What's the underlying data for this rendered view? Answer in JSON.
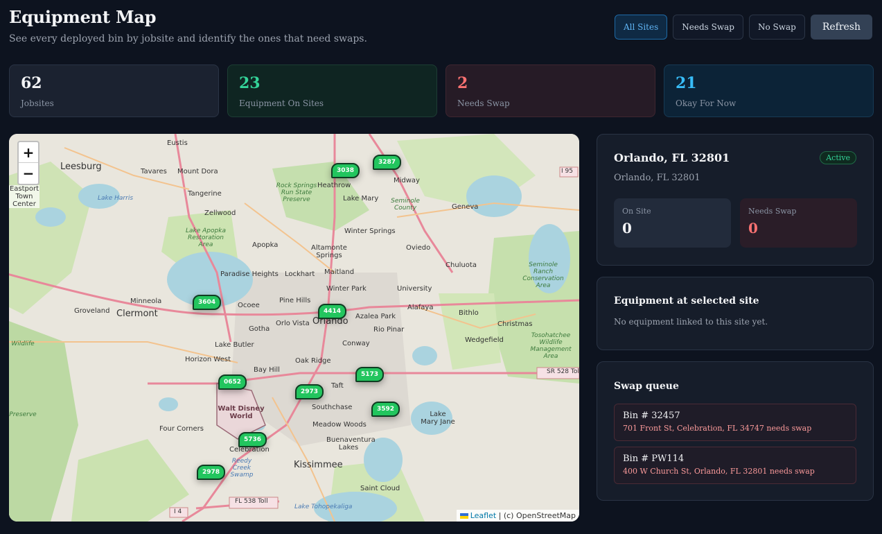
{
  "header": {
    "title": "Equipment Map",
    "subtitle": "See every deployed bin by jobsite and identify the ones that need swaps."
  },
  "filters": {
    "all_sites": "All Sites",
    "needs_swap": "Needs Swap",
    "no_swap": "No Swap",
    "refresh": "Refresh",
    "active_filter": "All Sites"
  },
  "stats": [
    {
      "value": "62",
      "label": "Jobsites"
    },
    {
      "value": "23",
      "label": "Equipment On Sites"
    },
    {
      "value": "2",
      "label": "Needs Swap"
    },
    {
      "value": "21",
      "label": "Okay For Now"
    }
  ],
  "map": {
    "zoom_in": "+",
    "zoom_out": "−",
    "attribution_leaflet": "Leaflet",
    "attribution_rest": " | (c) OpenStreetMap",
    "markers": [
      "3038",
      "3287",
      "3604",
      "4414",
      "5173",
      "0652",
      "2973",
      "3592",
      "5736",
      "2978"
    ],
    "place_labels": [
      "Eustis",
      "Leesburg",
      "Tavares",
      "Mount Dora",
      "Tangerine",
      "Zellwood",
      "Apopka",
      "Heathrow",
      "Midway",
      "Lake Mary",
      "Geneva",
      "Winter Springs",
      "Oviedo",
      "Altamonte Springs",
      "Chuluota",
      "Maitland",
      "Paradise Heights",
      "Lockhart",
      "Winter Park",
      "University",
      "Minneola",
      "Clermont",
      "Groveland",
      "Ocoee",
      "Pine Hills",
      "Alafaya",
      "Orlando",
      "Azalea Park",
      "Bithlo",
      "Christmas",
      "Gotha",
      "Orlo Vista",
      "Rio Pinar",
      "Wedgefield",
      "Lake Butler",
      "Conway",
      "Horizon West",
      "Oak Ridge",
      "Bay Hill",
      "Taft",
      "Walt Disney World",
      "Southchase",
      "Lake Mary Jane",
      "Four Corners",
      "Meadow Woods",
      "Celebration",
      "Buenaventura Lakes",
      "Kissimmee",
      "Saint Cloud",
      "Eastport Town Center",
      "Lake Harris",
      "Rock Springs Run State Preserve",
      "Seminole County",
      "Lake Apopka Restoration Area",
      "Seminole Ranch Conservation Area",
      "Tosohatchee Wildlife Management Area",
      "Reedy Creek Swamp",
      "Lake Tohopekaliga",
      "I 95",
      "SR 528 Toll",
      "FL 538 Toll",
      "I 4",
      "Wildlife",
      "Preserve"
    ]
  },
  "site": {
    "title": "Orlando, FL 32801",
    "subtitle": "Orlando, FL 32801",
    "status": "Active",
    "on_site_label": "On Site",
    "on_site_value": "0",
    "needs_swap_label": "Needs Swap",
    "needs_swap_value": "0"
  },
  "equipment": {
    "title": "Equipment at selected site",
    "empty": "No equipment linked to this site yet."
  },
  "swap_queue": {
    "title": "Swap queue",
    "items": [
      {
        "bin": "Bin # 32457",
        "address": "701 Front St, Celebration, FL 34747 needs swap"
      },
      {
        "bin": "Bin # PW114",
        "address": "400 W Church St, Orlando, FL 32801 needs swap"
      }
    ]
  },
  "colors": {
    "background": "#0d131f",
    "accent_green": "#22c55e",
    "accent_red": "#f87171",
    "accent_blue": "#38bdf8"
  }
}
